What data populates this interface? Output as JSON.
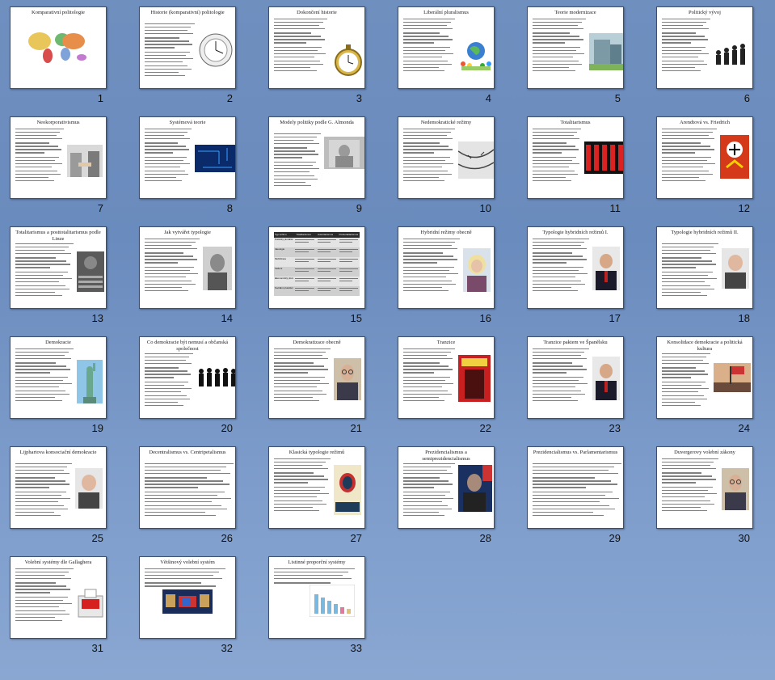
{
  "slides": [
    {
      "num": "1",
      "title": "Komparativní politologie",
      "pic": "world-map"
    },
    {
      "num": "2",
      "title": "Historie (komparativní) politologie",
      "pic": "clock-face"
    },
    {
      "num": "3",
      "title": "Dokončení historie",
      "pic": "pocket-watch"
    },
    {
      "num": "4",
      "title": "Liberální pluralismus",
      "pic": "globe-people"
    },
    {
      "num": "5",
      "title": "Teorie modernizace",
      "pic": "building"
    },
    {
      "num": "6",
      "title": "Politický vývoj",
      "pic": "evolution"
    },
    {
      "num": "7",
      "title": "Neokorporativismus",
      "pic": "handshake"
    },
    {
      "num": "8",
      "title": "Systémová teorie",
      "pic": "circuit"
    },
    {
      "num": "9",
      "title": "Modely politiky podle G. Almonda",
      "pic": "lincoln"
    },
    {
      "num": "10",
      "title": "Nedemokratické režimy",
      "pic": "barbed-wire"
    },
    {
      "num": "11",
      "title": "Totalitarismus",
      "pic": "totalitarian-poster"
    },
    {
      "num": "12",
      "title": "Arendtová vs. Friedrich",
      "pic": "swastika-hammer"
    },
    {
      "num": "13",
      "title": "Totalitarismus a posttotalitarismus podle Linze",
      "pic": "soviet-congress"
    },
    {
      "num": "14",
      "title": "Jak vytvářet typologie",
      "pic": "portrait"
    },
    {
      "num": "15",
      "title": "",
      "pic": "table"
    },
    {
      "num": "16",
      "title": "Hybridní režimy obecně",
      "pic": "portrait-woman"
    },
    {
      "num": "17",
      "title": "Typologie hybridních režimů I.",
      "pic": "portrait-suit"
    },
    {
      "num": "18",
      "title": "Typologie hybridních režimů II.",
      "pic": "portrait-older"
    },
    {
      "num": "19",
      "title": "Demokracie",
      "pic": "statue-liberty"
    },
    {
      "num": "20",
      "title": "Co demokracie být nemusí a občanská společnost",
      "pic": "silhouettes"
    },
    {
      "num": "21",
      "title": "Demokratizace obecně",
      "pic": "portrait-glasses"
    },
    {
      "num": "22",
      "title": "Tranzice",
      "pic": "vox-populi"
    },
    {
      "num": "23",
      "title": "Tranzice paktem ve Španělsku",
      "pic": "portrait-suit"
    },
    {
      "num": "24",
      "title": "Konsolidace demokracie a politická kultura",
      "pic": "flag-crowd"
    },
    {
      "num": "25",
      "title": "Lijphartova konsociační demokracie",
      "pic": "portrait-older"
    },
    {
      "num": "26",
      "title": "Decentralismus vs. Centripetalismus",
      "pic": "none"
    },
    {
      "num": "27",
      "title": "Klasická typologie režimů",
      "pic": "power-poster"
    },
    {
      "num": "28",
      "title": "Prezidencialismus a semiprezidencialismus",
      "pic": "portrait-dark"
    },
    {
      "num": "29",
      "title": "Prezidencialismus vs. Parlamentarismus",
      "pic": "none"
    },
    {
      "num": "30",
      "title": "Duvergerovy volební zákony",
      "pic": "portrait-glasses"
    },
    {
      "num": "31",
      "title": "Volební systémy dle Gallaghera",
      "pic": "vote-box"
    },
    {
      "num": "32",
      "title": "Většinový volební systém",
      "pic": "election-map"
    },
    {
      "num": "33",
      "title": "Listinné proporční systémy",
      "pic": "bar-chart"
    }
  ],
  "table_slide": {
    "headers": [
      "Typ režimu",
      "Totalitarismus",
      "Autoritarismus",
      "Posttotalitarismus"
    ],
    "rows": [
      "Politický pluralismus",
      "Ideologie",
      "Mobilizace",
      "Vedení",
      "Ekonomický pluralismus",
      "Sociální pluralismus"
    ]
  },
  "colors": {
    "background": "#6f8fbf",
    "slide_border": "#3d4f6e"
  }
}
